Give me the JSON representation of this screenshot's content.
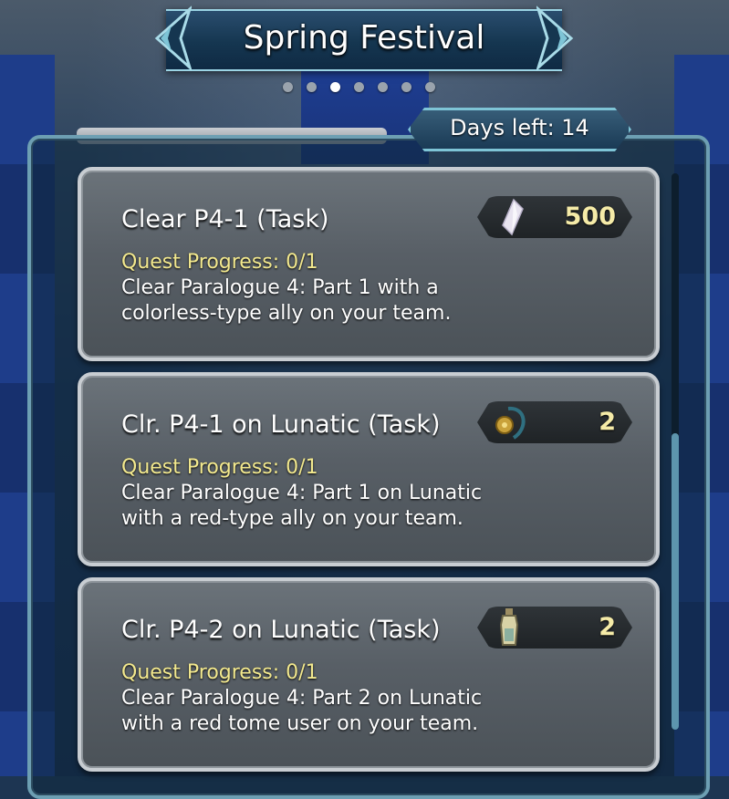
{
  "event": {
    "title": "Spring Festival",
    "page_count": 7,
    "active_page_index": 2
  },
  "days_left": {
    "label": "Days left: 14"
  },
  "quests": [
    {
      "name": "Clear P4-1 (Task)",
      "reward_icon": "orb-crystal-icon",
      "reward_amount": "500",
      "progress": "Quest Progress: 0/1",
      "description_line1": "Clear Paralogue 4: Part 1 with a",
      "description_line2": "colorless-type ally on your team."
    },
    {
      "name": "Clr. P4-1 on Lunatic (Task)",
      "reward_icon": "sacred-seal-amulet-icon",
      "reward_amount": "2",
      "progress": "Quest Progress: 0/1",
      "description_line1": "Clear Paralogue 4: Part 1 on Lunatic",
      "description_line2": "with a red-type ally on your team."
    },
    {
      "name": "Clr. P4-2 on Lunatic (Task)",
      "reward_icon": "refining-stone-vial-icon",
      "reward_amount": "2",
      "progress": "Quest Progress: 0/1",
      "description_line1": "Clear Paralogue 4: Part 2 on Lunatic",
      "description_line2": "with a red tome user on your team."
    }
  ],
  "colors": {
    "progress_text": "#f3e98e",
    "reward_amount_text": "#f5eba8",
    "frame_accent": "#6d9fb3"
  }
}
